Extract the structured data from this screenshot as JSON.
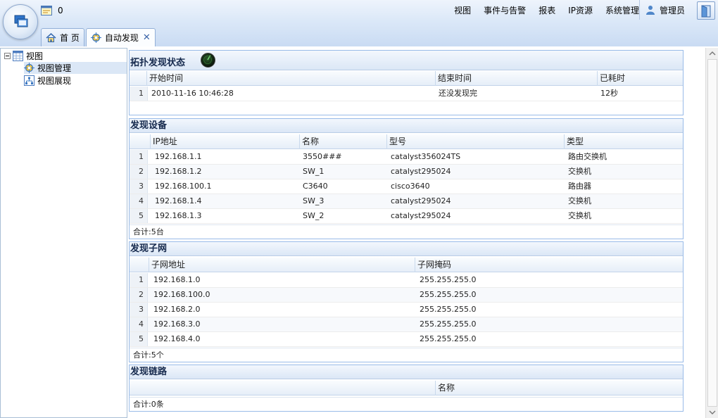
{
  "header": {
    "message_count": "0",
    "menu": [
      "视图",
      "事件与告警",
      "报表",
      "IP资源",
      "系统管理"
    ],
    "user_name": "管理员"
  },
  "tabs": [
    {
      "label": "首 页"
    },
    {
      "label": "自动发现",
      "close": "✕"
    }
  ],
  "tree": {
    "root": "视图",
    "children": [
      "视图管理",
      "视图展现"
    ]
  },
  "status_panel": {
    "title": "拓扑发现状态",
    "columns": [
      "开始时间",
      "结束时间",
      "已耗时"
    ],
    "rows": [
      {
        "num": "1",
        "start": "2010-11-16 10:46:28",
        "end": "还没发现完",
        "elapsed": "12秒"
      }
    ]
  },
  "devices_panel": {
    "title": "发现设备",
    "columns": [
      "IP地址",
      "名称",
      "型号",
      "类型"
    ],
    "rows": [
      {
        "num": "1",
        "ip": "192.168.1.1",
        "name": "3550###",
        "model": "catalyst356024TS",
        "type": "路由交换机"
      },
      {
        "num": "2",
        "ip": "192.168.1.2",
        "name": "SW_1",
        "model": "catalyst295024",
        "type": "交换机"
      },
      {
        "num": "3",
        "ip": "192.168.100.1",
        "name": "C3640",
        "model": "cisco3640",
        "type": "路由器"
      },
      {
        "num": "4",
        "ip": "192.168.1.4",
        "name": "SW_3",
        "model": "catalyst295024",
        "type": "交换机"
      },
      {
        "num": "5",
        "ip": "192.168.1.3",
        "name": "SW_2",
        "model": "catalyst295024",
        "type": "交换机"
      }
    ],
    "footer": "合计:5台"
  },
  "subnets_panel": {
    "title": "发现子网",
    "columns": [
      "子网地址",
      "子网掩码"
    ],
    "rows": [
      {
        "num": "1",
        "addr": "192.168.1.0",
        "mask": "255.255.255.0"
      },
      {
        "num": "2",
        "addr": "192.168.100.0",
        "mask": "255.255.255.0"
      },
      {
        "num": "3",
        "addr": "192.168.2.0",
        "mask": "255.255.255.0"
      },
      {
        "num": "4",
        "addr": "192.168.3.0",
        "mask": "255.255.255.0"
      },
      {
        "num": "5",
        "addr": "192.168.4.0",
        "mask": "255.255.255.0"
      }
    ],
    "footer": "合计:5个"
  },
  "links_panel": {
    "title": "发现链路",
    "columns": [
      "名称"
    ],
    "footer": "合计:0条"
  },
  "colors": {
    "accent": "#99bbe8",
    "header_bg": "#dbe8f8",
    "selected": "#dbe7f6"
  },
  "icons": {
    "logo": "app-logo-icon",
    "message": "message-icon",
    "user": "user-icon",
    "exit": "exit-icon",
    "home": "home-icon",
    "discover": "discover-icon",
    "tree_root": "view-grid-icon",
    "tree_manage": "view-manage-icon",
    "tree_show": "view-show-icon",
    "radar": "radar-icon"
  }
}
